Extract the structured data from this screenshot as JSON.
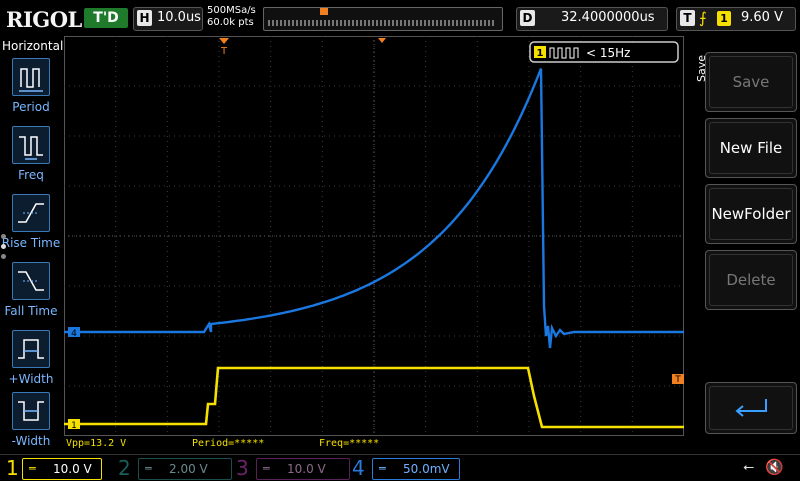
{
  "brand": "RIGOL",
  "run_status": "T'D",
  "timebase": {
    "key": "H",
    "value": "10.0us"
  },
  "sampling": {
    "rate": "500MSa/s",
    "points": "60.0k pts"
  },
  "delay": {
    "key": "D",
    "value": "32.4000000us"
  },
  "trigger": {
    "key": "T",
    "channel": "1",
    "level": "9.60 V"
  },
  "left_menu": {
    "title": "Horizontal",
    "items": [
      {
        "label": "Period"
      },
      {
        "label": "Freq"
      },
      {
        "label": "Rise Time"
      },
      {
        "label": "Fall Time"
      },
      {
        "label": "+Width"
      },
      {
        "label": "-Width"
      }
    ]
  },
  "right_menu": {
    "title": "Save",
    "buttons": [
      {
        "label": "Save",
        "enabled": false
      },
      {
        "label": "New File",
        "enabled": true
      },
      {
        "label": "NewFolder",
        "enabled": true
      },
      {
        "label": "Delete",
        "enabled": false
      }
    ],
    "back_icon": "return-arrow-icon"
  },
  "freq_label": {
    "channel": "1",
    "text": "< 15Hz"
  },
  "measurements": {
    "vpp": "Vpp=13.2 V",
    "period": "Period=*****",
    "freq": "Freq=*****"
  },
  "channels": [
    {
      "num": "1",
      "scale": "10.0 V",
      "color": "#f6e000",
      "active": true
    },
    {
      "num": "2",
      "scale": "2.00 V",
      "color": "#1fa3a0",
      "active": false
    },
    {
      "num": "3",
      "scale": "10.0 V",
      "color": "#c040c0",
      "active": false
    },
    {
      "num": "4",
      "scale": "50.0mV",
      "color": "#2a7ad8",
      "active": true
    }
  ],
  "markers": {
    "ch4": "4",
    "ch1": "1",
    "trig": "T"
  },
  "colors": {
    "ch1": "#f6e000",
    "ch4": "#1a78e0",
    "trigger": "#f08020",
    "grid": "#444"
  }
}
